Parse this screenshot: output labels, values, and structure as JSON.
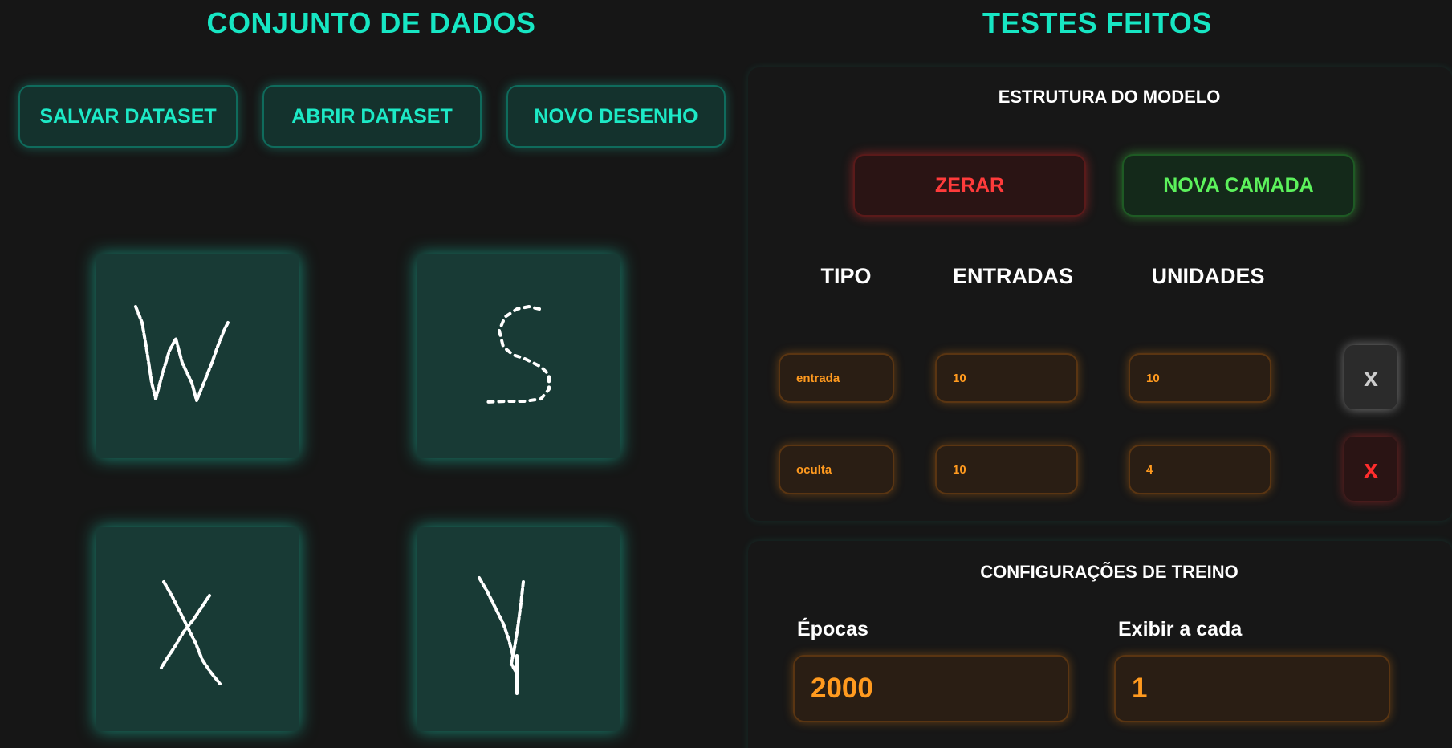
{
  "dataset": {
    "title": "CONJUNTO DE DADOS",
    "buttons": {
      "save": "SALVAR DATASET",
      "open": "ABRIR DATASET",
      "new_drawing": "NOVO DESENHO"
    },
    "samples": [
      "W",
      "S",
      "X",
      "Y"
    ]
  },
  "tests": {
    "title": "TESTES FEITOS"
  },
  "model": {
    "title": "ESTRUTURA DO MODELO",
    "reset_label": "ZERAR",
    "new_layer_label": "NOVA CAMADA",
    "columns": {
      "type": "TIPO",
      "inputs": "ENTRADAS",
      "units": "UNIDADES"
    },
    "layers": [
      {
        "type": "entrada",
        "inputs": "10",
        "units": "10",
        "delete": "x"
      },
      {
        "type": "oculta",
        "inputs": "10",
        "units": "4",
        "delete": "x"
      }
    ]
  },
  "training": {
    "title": "CONFIGURAÇÕES DE TREINO",
    "epochs_label": "Épocas",
    "epochs_value": "2000",
    "display_label": "Exibir a cada",
    "display_value": "1"
  },
  "colors": {
    "accent": "#17e6c3",
    "danger": "#ff3b3b",
    "success": "#5cf25c",
    "field_text": "#ff9a1f"
  }
}
